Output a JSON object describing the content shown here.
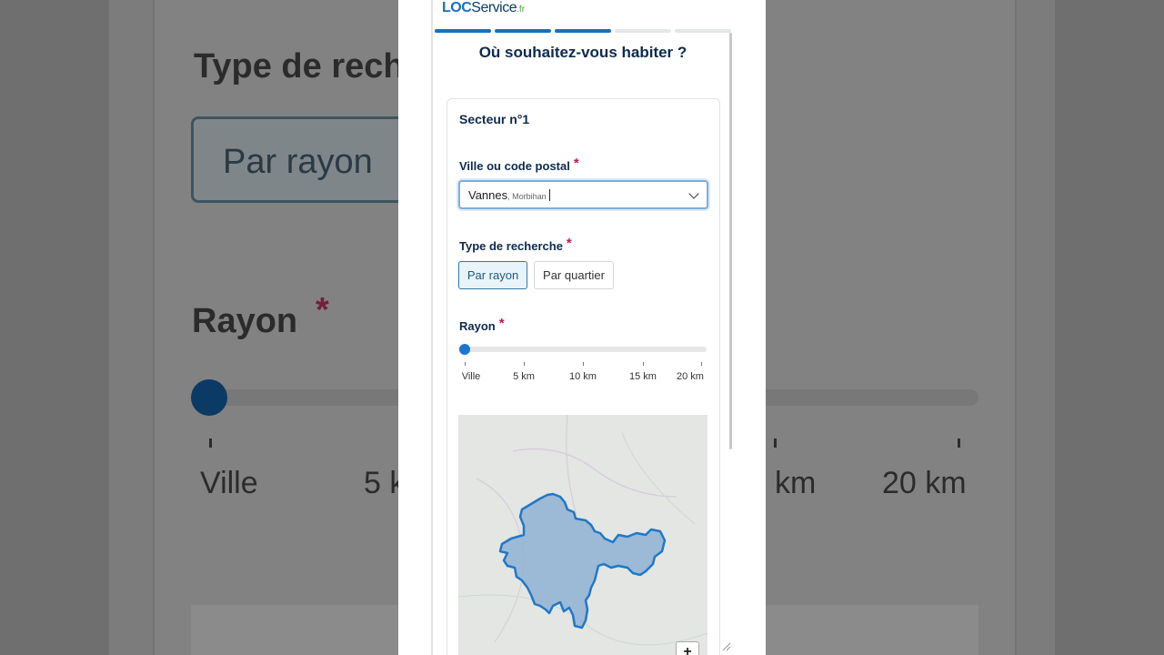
{
  "logo": {
    "loc": "LOC",
    "service": "Service",
    "tld": ".fr"
  },
  "progress": {
    "total_steps": 5,
    "completed_steps": 3,
    "active_color": "#1a6fbf",
    "inactive_color": "#e3e6ea"
  },
  "page": {
    "title": "Où souhaitez-vous habiter ?"
  },
  "sector": {
    "heading": "Secteur n°1",
    "city_label": "Ville ou code postal",
    "required_mark": "*",
    "city_value": "Vannes",
    "city_subtext": ", Morbihan",
    "search_type_label": "Type de recherche",
    "search_type_options": [
      "Par rayon",
      "Par quartier"
    ],
    "search_type_selected": "Par rayon",
    "radius_label": "Rayon",
    "radius_ticks": [
      "Ville",
      "5 km",
      "10 km",
      "15 km",
      "20 km"
    ],
    "radius_value": "Ville"
  },
  "map": {
    "zoom_in_label": "+",
    "area_name": "Vannes",
    "region_color": "#1f78c8"
  },
  "background": {
    "heading": "Type de rech",
    "button": "Par rayon",
    "rayon": "Rayon",
    "star": "*",
    "labels": [
      "Ville",
      "5 k",
      "km",
      "20 km"
    ]
  }
}
